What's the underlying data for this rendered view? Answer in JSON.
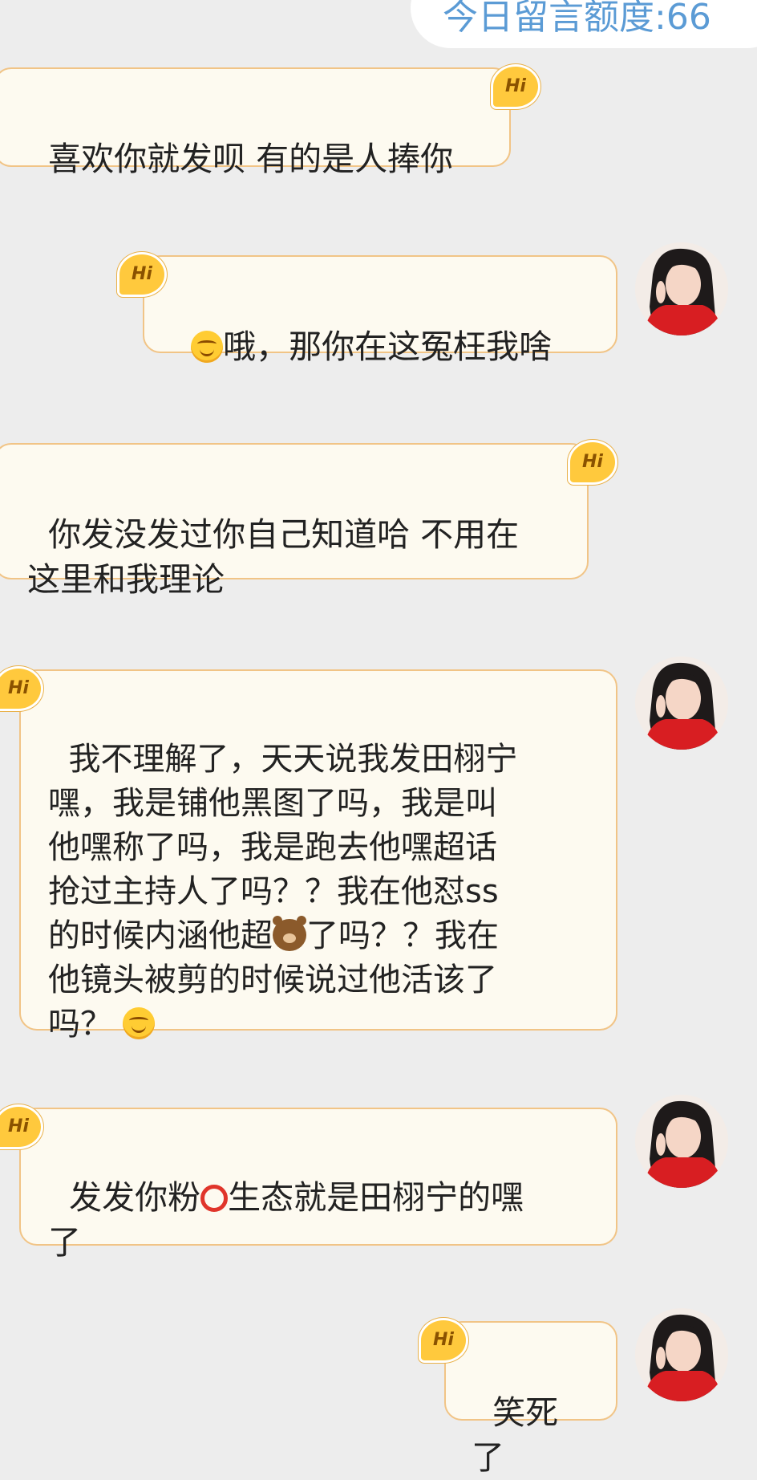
{
  "header": {
    "quota_text": "今日留言额度:66"
  },
  "badge_label": "Hi",
  "messages": [
    {
      "text": "喜欢你就发呗 有的是人捧你"
    },
    {
      "text_after_emoji": "哦，那你在这冤枉我啥",
      "emoji": "smiling-face-icon"
    },
    {
      "text": "你发没发过你自己知道哈 不用在\n这里和我理论"
    },
    {
      "text_part1": "我不理解了，天天说我发田栩宁\n嘿，我是铺他黑图了吗，我是叫\n他嘿称了吗，我是跑去他嘿超话\n抢过主持人了吗？？我在他怼ss\n的时候内涵他超",
      "emoji1": "bear-face-icon",
      "text_part2": "了吗？？我在\n他镜头被剪的时候说过他活该了\n吗？",
      "emoji2": "smiling-face-icon"
    },
    {
      "text_part1": "发发你粉",
      "emoji": "red-circle-icon",
      "text_part2": "生态就是田栩宁的嘿\n了"
    },
    {
      "text": "笑死了"
    }
  ],
  "colors": {
    "background": "#ededed",
    "bubble_fill": "#fdfaf0",
    "bubble_border": "#f1c486",
    "badge_fill": "#ffc93d",
    "quota_text": "#5b9bd5"
  }
}
